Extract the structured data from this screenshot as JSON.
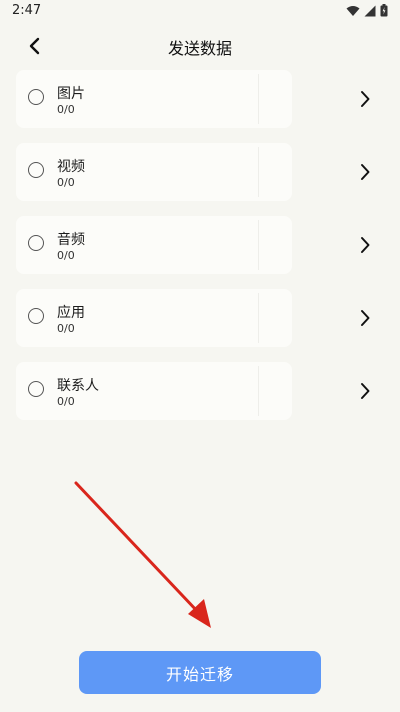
{
  "status_bar": {
    "time": "2:47",
    "icons": [
      "wifi-icon",
      "signal-icon",
      "battery-icon"
    ]
  },
  "header": {
    "title": "发送数据",
    "back_icon": "chevron-left-icon"
  },
  "items": [
    {
      "label": "图片",
      "count": "0/0"
    },
    {
      "label": "视频",
      "count": "0/0"
    },
    {
      "label": "音频",
      "count": "0/0"
    },
    {
      "label": "应用",
      "count": "0/0"
    },
    {
      "label": "联系人",
      "count": "0/0"
    }
  ],
  "start_button": {
    "label": "开始迁移"
  },
  "colors": {
    "background": "#f6f6f1",
    "card": "#fcfcf9",
    "accent": "#5e98f6",
    "annotation_arrow": "#d9261c"
  }
}
